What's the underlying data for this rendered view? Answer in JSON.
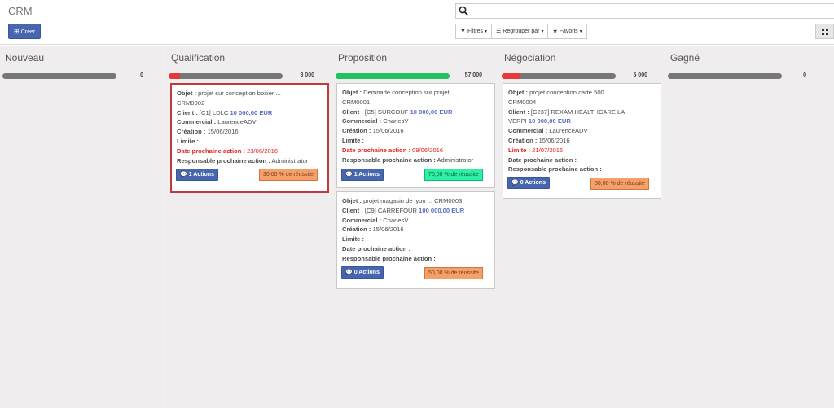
{
  "header": {
    "breadcrumb": "CRM",
    "create_label": "Créer",
    "search_value": "|",
    "filters_label": "Filtres",
    "group_by_label": "Regrouper par",
    "favorites_label": "Favoris"
  },
  "columns": [
    {
      "title": "Nouveau",
      "amount": "0",
      "progress": {
        "red": 0,
        "green": 0
      }
    },
    {
      "title": "Qualification",
      "amount": "3 000",
      "progress": {
        "red": 0.1,
        "green": 0
      }
    },
    {
      "title": "Proposition",
      "amount": "57 000",
      "progress": {
        "red": 0,
        "green": 1.0
      }
    },
    {
      "title": "Négociation",
      "amount": "5 000",
      "progress": {
        "red": 0.16,
        "green": 0
      }
    },
    {
      "title": "Gagné",
      "amount": "0",
      "progress": {
        "red": 0,
        "green": 0
      }
    }
  ],
  "labels": {
    "objet": "Objet :",
    "client": "Client :",
    "commercial": "Commercial :",
    "creation": "Création :",
    "limite": "Limite :",
    "date_prochaine": "Date prochaine action :",
    "responsable": "Responsable prochaine action :"
  },
  "cards": {
    "crm0002": {
      "objet": "projet sur conception boitier ...",
      "ref": "CRM0002",
      "client": "[C1] LDLC",
      "amount": "10 000,00 EUR",
      "commercial": "LaurenceADV",
      "creation": "15/06/2016",
      "limite": "",
      "date_prochaine": "23/06/2016",
      "responsable": "Administrator",
      "actions": "1 Actions",
      "rate": "30,00 % de réussite"
    },
    "crm0001": {
      "objet": "Demnade conception sur projet ...",
      "ref": "CRM0001",
      "client": "[C5] SURCOUF",
      "amount": "10 000,00 EUR",
      "commercial": "CharlesV",
      "creation": "15/06/2016",
      "limite": "",
      "date_prochaine": "09/06/2016",
      "responsable": "Administrator",
      "actions": "1 Actions",
      "rate": "70,00 % de réussite"
    },
    "crm0003": {
      "objet": "projet magasin de lyon ... CRM0003",
      "client": "[C9] CARREFOUR",
      "amount": "100 000,00 EUR",
      "commercial": "CharlesV",
      "creation": "15/06/2016",
      "limite": "",
      "date_prochaine": "",
      "responsable": "",
      "actions": "0 Actions",
      "rate": "50,00 % de réussite"
    },
    "crm0004": {
      "objet": "projet conception carte 500 ...",
      "ref": "CRM0004",
      "client": "[C237] REXAM HEALTHCARE LA",
      "client_line2": "VERPI",
      "amount": "10 000,00 EUR",
      "commercial": "LaurenceADV",
      "creation": "15/06/2016",
      "limite": "21/07/2016",
      "date_prochaine": "",
      "responsable": "",
      "actions": "0 Actions",
      "rate": "50,00 % de réussite"
    }
  },
  "colors": {
    "primary": "#4666b0",
    "progress_grey": "#777777",
    "progress_red": "#e5393b",
    "progress_green": "#21c261",
    "rate_orange": "#f5a06a",
    "rate_green": "#2bf1a4",
    "overdue_red": "#e3221c",
    "amount_blue": "#5a6ec0"
  },
  "icons": {
    "create": "plus-square-icon",
    "search": "search-icon",
    "filter": "filter-icon",
    "group": "bars-icon",
    "favorites": "star-icon",
    "kanban_view": "th-large-icon",
    "actions": "comments-icon"
  }
}
